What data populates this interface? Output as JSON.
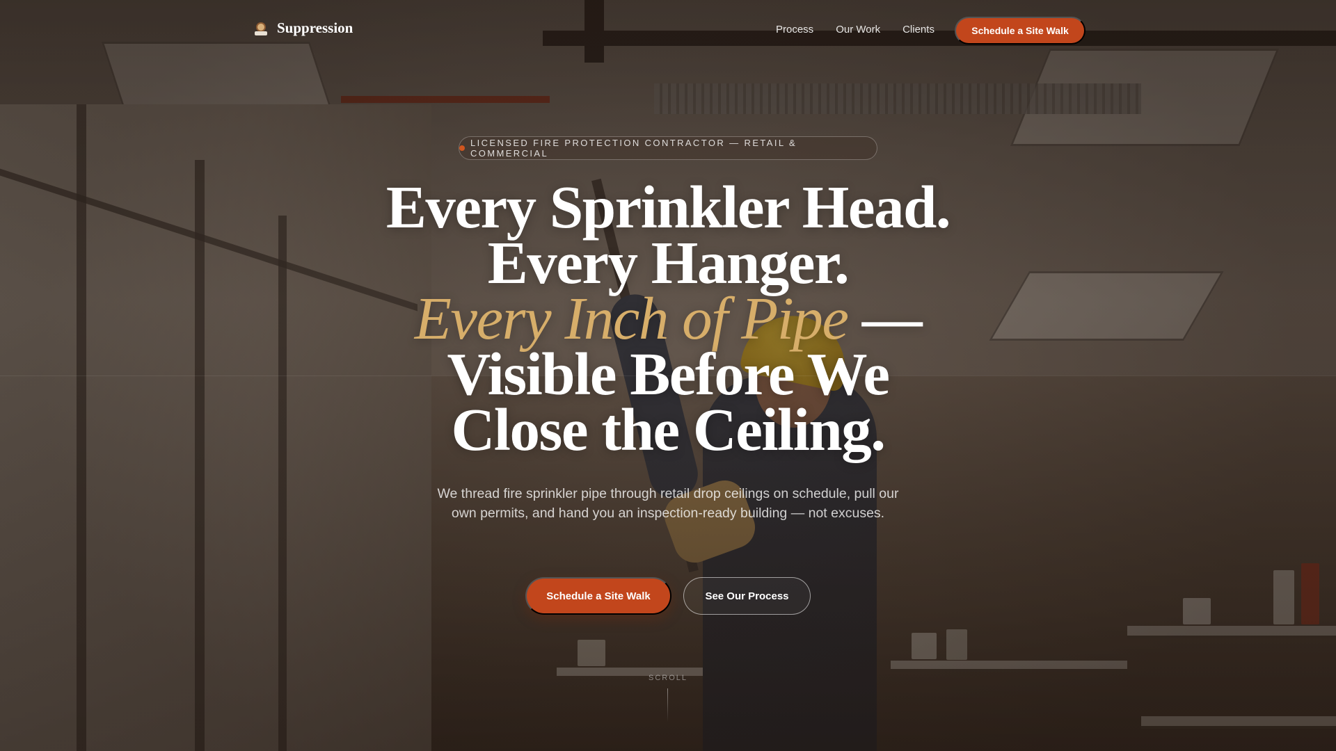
{
  "nav": {
    "brand_name": "Suppression",
    "brand_icon": "firefighter-logo-icon",
    "links": [
      "Process",
      "Our Work",
      "Clients"
    ],
    "cta_label": "Schedule a Site Walk"
  },
  "hero": {
    "badge_text": "LICENSED FIRE PROTECTION CONTRACTOR — RETAIL & COMMERCIAL",
    "headline": {
      "line1": "Every Sprinkler Head.",
      "line2": "Every Hanger.",
      "line3_accent": "Every Inch of Pipe",
      "line3_rest": " —",
      "line4": "Visible Before We",
      "line5": "Close the Ceiling."
    },
    "subtext": "We thread fire sprinkler pipe through retail drop ceilings on schedule, pull our own permits, and hand you an inspection-ready building — not excuses.",
    "primary_cta": "Schedule a Site Walk",
    "secondary_cta": "See Our Process",
    "scroll_label": "SCROLL"
  },
  "colors": {
    "accent": "#c2461c",
    "headline_accent": "#d7ae6a",
    "badge_dot": "#d0561f"
  }
}
